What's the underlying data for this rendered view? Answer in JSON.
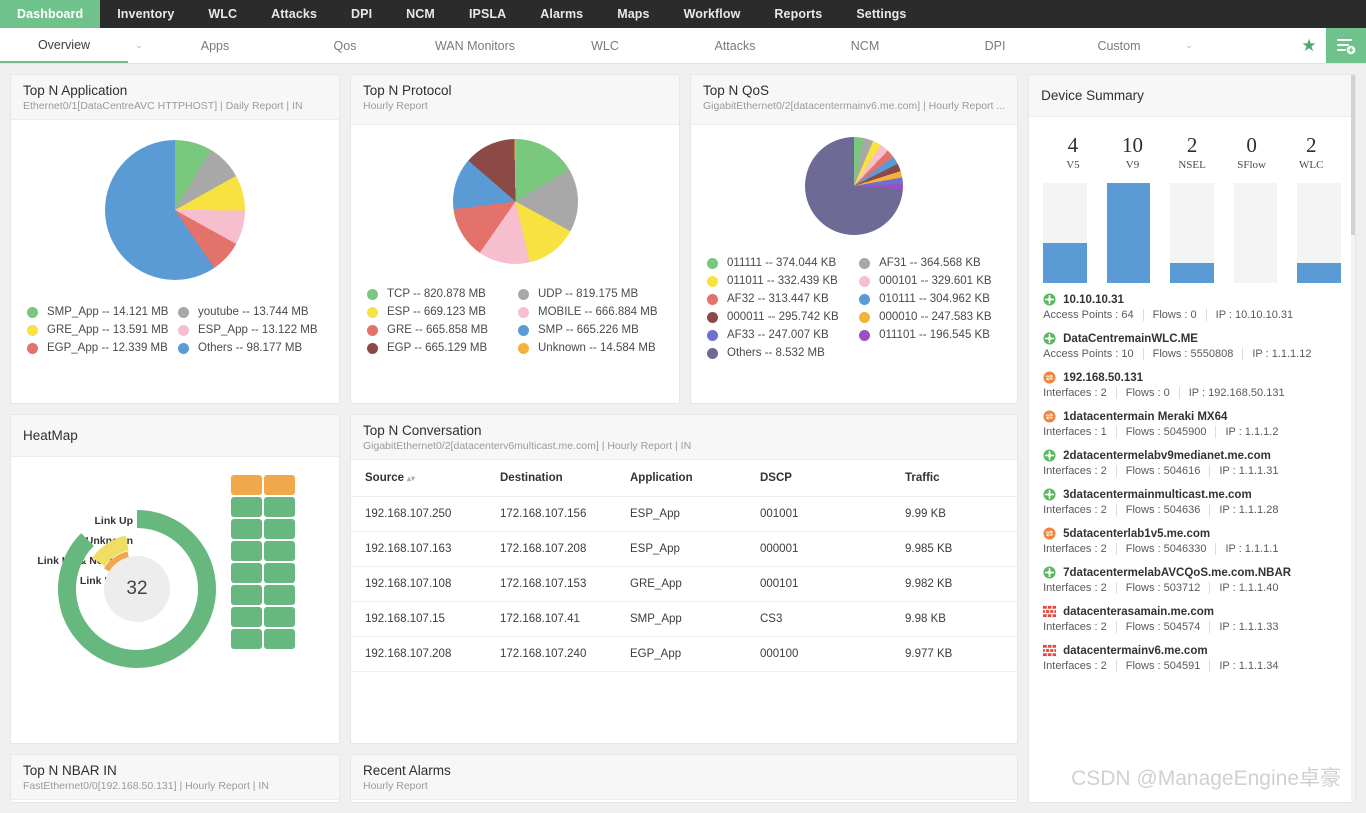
{
  "topnav": {
    "items": [
      {
        "label": "Dashboard",
        "active": true
      },
      {
        "label": "Inventory",
        "active": false
      },
      {
        "label": "WLC",
        "active": false
      },
      {
        "label": "Attacks",
        "active": false
      },
      {
        "label": "DPI",
        "active": false
      },
      {
        "label": "NCM",
        "active": false
      },
      {
        "label": "IPSLA",
        "active": false
      },
      {
        "label": "Alarms",
        "active": false
      },
      {
        "label": "Maps",
        "active": false
      },
      {
        "label": "Workflow",
        "active": false
      },
      {
        "label": "Reports",
        "active": false
      },
      {
        "label": "Settings",
        "active": false
      }
    ],
    "active_color": "#6fc28b",
    "bg_color": "#2b2b2b"
  },
  "subnav": {
    "items": [
      {
        "label": "Overview",
        "active": true
      },
      {
        "label": "Apps",
        "active": false
      },
      {
        "label": "Qos",
        "active": false
      },
      {
        "label": "WAN Monitors",
        "active": false
      },
      {
        "label": "WLC",
        "active": false
      },
      {
        "label": "Attacks",
        "active": false
      },
      {
        "label": "NCM",
        "active": false
      },
      {
        "label": "DPI",
        "active": false
      },
      {
        "label": "Custom",
        "active": false
      }
    ],
    "caret": "⌄",
    "star": "★",
    "add_widget_icon": "add-widget-icon"
  },
  "cards": {
    "top_n_application": {
      "title": "Top N Application",
      "subtitle": "Ethernet0/1[DataCentreAVC HTTPHOST] | Daily Report | IN"
    },
    "top_n_protocol": {
      "title": "Top N Protocol",
      "subtitle": "Hourly Report"
    },
    "top_n_qos": {
      "title": "Top N QoS",
      "subtitle": "GigabitEthernet0/2[datacentermainv6.me.com] | Hourly Report ..."
    },
    "device_summary": {
      "title": "Device Summary"
    },
    "heatmap": {
      "title": "HeatMap"
    },
    "top_n_conversation": {
      "title": "Top N Conversation",
      "subtitle": "GigabitEthernet0/2[datacenterv6multicast.me.com] | Hourly Report | IN"
    },
    "recent_alarms": {
      "title": "Recent Alarms",
      "subtitle": "Hourly Report"
    },
    "top_n_nbar_in": {
      "title": "Top N NBAR IN",
      "subtitle": "FastEthernet0/0[192.168.50.131] | Hourly Report | IN"
    }
  },
  "chart_data": [
    {
      "type": "pie",
      "title": "Top N Application",
      "unit": "MB",
      "categories": [
        "SMP_App",
        "youtube",
        "GRE_App",
        "ESP_App",
        "EGP_App",
        "Others"
      ],
      "values": [
        14.121,
        13.744,
        13.591,
        13.122,
        12.339,
        98.177
      ],
      "colors": [
        "#7ac77e",
        "#a8a8a8",
        "#f7e242",
        "#f7bfcd",
        "#e3726b",
        "#5b9bd5"
      ],
      "legend": [
        "SMP_App -- 14.121 MB",
        "youtube -- 13.744 MB",
        "GRE_App -- 13.591 MB",
        "ESP_App -- 13.122 MB",
        "EGP_App -- 12.339 MB",
        "Others -- 98.177 MB"
      ],
      "legend_order": [
        "SMP_App -- 14.121 MB",
        "GRE_App -- 13.591 MB",
        "EGP_App -- 12.339 MB",
        "youtube -- 13.744 MB",
        "ESP_App -- 13.122 MB",
        "Others -- 98.177 MB"
      ],
      "legend_colors_order": [
        "#7ac77e",
        "#f7e242",
        "#e3726b",
        "#a8a8a8",
        "#f7bfcd",
        "#5b9bd5"
      ]
    },
    {
      "type": "pie",
      "title": "Top N Protocol",
      "unit": "MB",
      "categories": [
        "TCP",
        "UDP",
        "ESP",
        "MOBILE",
        "GRE",
        "SMP",
        "EGP",
        "Unknown"
      ],
      "values": [
        820.878,
        819.175,
        669.123,
        666.884,
        665.858,
        665.226,
        665.129,
        14.584
      ],
      "colors": [
        "#7ac77e",
        "#a8a8a8",
        "#f7e242",
        "#f7bfcd",
        "#e3726b",
        "#5b9bd5",
        "#8c4a47",
        "#f2b23c"
      ],
      "legend_order": [
        "TCP -- 820.878 MB",
        "ESP -- 669.123 MB",
        "GRE -- 665.858 MB",
        "EGP -- 665.129 MB",
        "UDP -- 819.175 MB",
        "MOBILE -- 666.884 MB",
        "SMP -- 665.226 MB",
        "Unknown -- 14.584 MB"
      ],
      "legend_colors_order": [
        "#7ac77e",
        "#f7e242",
        "#e3726b",
        "#8c4a47",
        "#a8a8a8",
        "#f7bfcd",
        "#5b9bd5",
        "#f2b23c"
      ]
    },
    {
      "type": "pie",
      "title": "Top N QoS",
      "unit": "KB",
      "categories": [
        "011111",
        "AF31",
        "011011",
        "000101",
        "AF32",
        "010111",
        "000011",
        "000010",
        "AF33",
        "011101",
        "Others"
      ],
      "values": [
        374.044,
        364.568,
        332.439,
        329.601,
        313.447,
        304.962,
        295.742,
        247.583,
        247.007,
        196.545,
        8532
      ],
      "colors": [
        "#7ac77e",
        "#a8a8a8",
        "#f7e242",
        "#f7bfcd",
        "#e3726b",
        "#5b9bd5",
        "#8c4a47",
        "#f2b23c",
        "#6f6fd0",
        "#9b4fc4",
        "#6d6b96"
      ],
      "legend_order": [
        "011111 -- 374.044 KB",
        "011011 -- 332.439 KB",
        "AF32 -- 313.447 KB",
        "000011 -- 295.742 KB",
        "AF33 -- 247.007 KB",
        "Others -- 8.532 MB",
        "AF31 -- 364.568 KB",
        "000101 -- 329.601 KB",
        "010111 -- 304.962 KB",
        "000010 -- 247.583 KB",
        "011101 -- 196.545 KB"
      ],
      "legend_colors_order": [
        "#7ac77e",
        "#f7e242",
        "#e3726b",
        "#8c4a47",
        "#6f6fd0",
        "#6d6b96",
        "#a8a8a8",
        "#f7bfcd",
        "#5b9bd5",
        "#f2b23c",
        "#9b4fc4"
      ]
    },
    {
      "type": "bar",
      "title": "Device Summary",
      "categories": [
        "V5",
        "V9",
        "NSEL",
        "SFlow",
        "WLC"
      ],
      "values": [
        4,
        10,
        2,
        0,
        2
      ],
      "ylim": [
        0,
        10
      ],
      "bar_color": "#5b9bd5",
      "track_color": "#f4f4f4"
    },
    {
      "type": "pie",
      "title": "HeatMap",
      "center_value": "32",
      "categories": [
        "Link Up",
        "Unknown",
        "Link Up & NoFlows",
        "Link Down"
      ],
      "values": [
        28,
        2,
        2,
        0
      ],
      "colors": [
        "#66b87e",
        "#f0dd63",
        "#f0a84a",
        "#e3726b"
      ],
      "grid_cells": [
        "#f0a84a",
        "#f0a84a",
        "#66b87e",
        "#66b87e",
        "#66b87e",
        "#66b87e",
        "#66b87e",
        "#66b87e",
        "#66b87e",
        "#66b87e",
        "#66b87e",
        "#66b87e",
        "#66b87e",
        "#66b87e",
        "#66b87e",
        "#66b87e"
      ]
    }
  ],
  "device_summary": {
    "stats": [
      {
        "value": "4",
        "label": "V5"
      },
      {
        "value": "10",
        "label": "V9"
      },
      {
        "value": "2",
        "label": "NSEL"
      },
      {
        "value": "0",
        "label": "SFlow"
      },
      {
        "value": "2",
        "label": "WLC"
      }
    ],
    "bars": [
      40,
      100,
      20,
      0,
      20
    ],
    "devices": [
      {
        "icon": "router-green-icon",
        "icon_color": "#5cb85c",
        "name": "10.10.10.31",
        "meta": [
          "Access Points : 64",
          "Flows : 0",
          "IP : 10.10.10.31"
        ]
      },
      {
        "icon": "router-green-icon",
        "icon_color": "#5cb85c",
        "name": "DataCentremainWLC.ME",
        "meta": [
          "Access Points : 10",
          "Flows : 5550808",
          "IP : 1.1.1.12"
        ]
      },
      {
        "icon": "router-orange-icon",
        "icon_color": "#f0843c",
        "name": "192.168.50.131",
        "meta": [
          "Interfaces : 2",
          "Flows : 0",
          "IP : 192.168.50.131"
        ]
      },
      {
        "icon": "router-orange-icon",
        "icon_color": "#f0843c",
        "name": "1datacentermain Meraki MX64",
        "meta": [
          "Interfaces : 1",
          "Flows : 5045900",
          "IP : 1.1.1.2"
        ]
      },
      {
        "icon": "router-green-icon",
        "icon_color": "#5cb85c",
        "name": "2datacentermelabv9medianet.me.com",
        "meta": [
          "Interfaces : 2",
          "Flows : 504616",
          "IP : 1.1.1.31"
        ]
      },
      {
        "icon": "router-green-icon",
        "icon_color": "#5cb85c",
        "name": "3datacentermainmulticast.me.com",
        "meta": [
          "Interfaces : 2",
          "Flows : 504636",
          "IP : 1.1.1.28"
        ]
      },
      {
        "icon": "router-orange-icon",
        "icon_color": "#f0843c",
        "name": "5datacenterlab1v5.me.com",
        "meta": [
          "Interfaces : 2",
          "Flows : 5046330",
          "IP : 1.1.1.1"
        ]
      },
      {
        "icon": "router-green-icon",
        "icon_color": "#5cb85c",
        "name": "7datacentermelabAVCQoS.me.com.NBAR",
        "meta": [
          "Interfaces : 2",
          "Flows : 503712",
          "IP : 1.1.1.40"
        ]
      },
      {
        "icon": "firewall-red-icon",
        "icon_color": "#e8453c",
        "name": "datacenterasamain.me.com",
        "meta": [
          "Interfaces : 2",
          "Flows : 504574",
          "IP : 1.1.1.33"
        ]
      },
      {
        "icon": "firewall-red-icon",
        "icon_color": "#e8453c",
        "name": "datacentermainv6.me.com",
        "meta": [
          "Interfaces : 2",
          "Flows : 504591",
          "IP : 1.1.1.34"
        ]
      }
    ]
  },
  "heatmap": {
    "labels": [
      "Link Up",
      "Unknown",
      "Link Up & NoFlows",
      "Link Down"
    ],
    "center_value": "32"
  },
  "conversation_table": {
    "columns": [
      "Source",
      "Destination",
      "Application",
      "DSCP",
      "Traffic"
    ],
    "sorted_column": "Source",
    "rows": [
      [
        "192.168.107.250",
        "172.168.107.156",
        "ESP_App",
        "001001",
        "9.99 KB"
      ],
      [
        "192.168.107.163",
        "172.168.107.208",
        "ESP_App",
        "000001",
        "9.985 KB"
      ],
      [
        "192.168.107.108",
        "172.168.107.153",
        "GRE_App",
        "000101",
        "9.982 KB"
      ],
      [
        "192.168.107.15",
        "172.168.107.41",
        "SMP_App",
        "CS3",
        "9.98 KB"
      ],
      [
        "192.168.107.208",
        "172.168.107.240",
        "EGP_App",
        "000100",
        "9.977 KB"
      ]
    ]
  },
  "watermark": "CSDN @ManageEngine卓豪"
}
